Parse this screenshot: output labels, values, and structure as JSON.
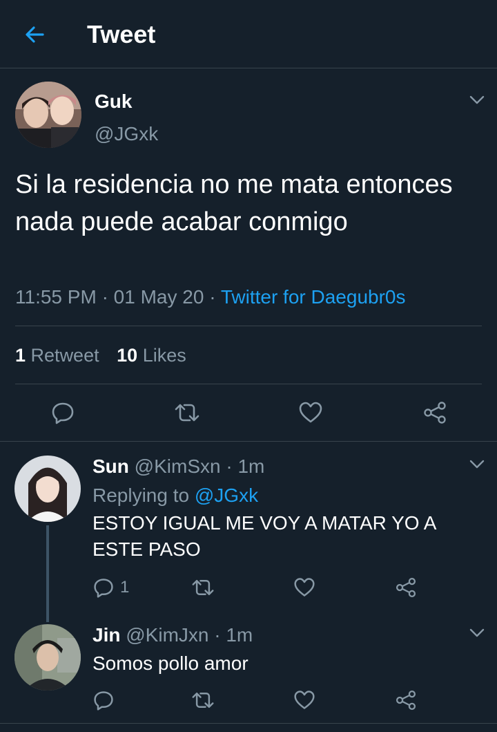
{
  "header": {
    "title": "Tweet"
  },
  "main_tweet": {
    "name": "Guk",
    "handle": "@JGxk",
    "text": "Si la residencia no me mata entonces nada puede acabar conmigo",
    "time": "11:55 PM",
    "date": "01 May 20",
    "separator": "·",
    "source": "Twitter for Daegubr0s",
    "retweets_count": "1",
    "retweets_label": "Retweet",
    "likes_count": "10",
    "likes_label": "Likes"
  },
  "replies": [
    {
      "name": "Sun",
      "handle": "@KimSxn",
      "time": "· 1m",
      "replying_prefix": "Replying to",
      "replying_to": "@JGxk",
      "text": "ESTOY IGUAL ME VOY A MATAR YO A ESTE PASO",
      "reply_count": "1"
    },
    {
      "name": "Jin",
      "handle": "@KimJxn",
      "time": "· 1m",
      "text": "Somos pollo amor"
    }
  ],
  "colors": {
    "background": "#15202b",
    "accent": "#1da1f2",
    "secondary_text": "#8899a6",
    "divider": "#38444d"
  },
  "icons": [
    "back-arrow-icon",
    "chevron-down-icon",
    "reply-icon",
    "retweet-icon",
    "like-icon",
    "share-icon"
  ]
}
